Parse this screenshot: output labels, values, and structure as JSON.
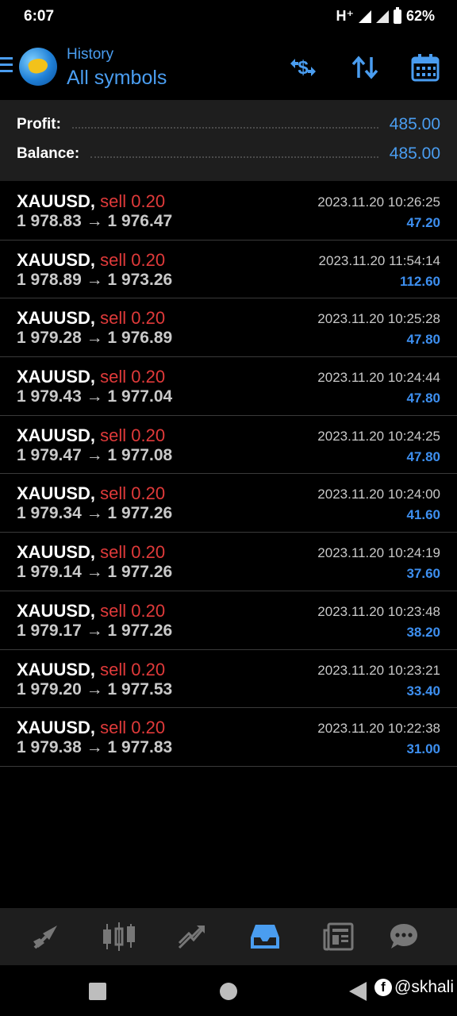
{
  "status_bar": {
    "time": "6:07",
    "network": "H⁺",
    "battery": "62%"
  },
  "header": {
    "subtitle": "History",
    "title": "All symbols",
    "icons": [
      "dollar-swap-icon",
      "sort-icon",
      "calendar-icon"
    ],
    "accent_color": "#4a9df0"
  },
  "summary": {
    "profit_label": "Profit:",
    "profit_value": "485.00",
    "balance_label": "Balance:",
    "balance_value": "485.00"
  },
  "deals": [
    {
      "symbol": "XAUUSD,",
      "side": "sell 0.20",
      "open": "1 978.83",
      "close": "1 976.47",
      "time": "2023.11.20 10:26:25",
      "profit": "47.20"
    },
    {
      "symbol": "XAUUSD,",
      "side": "sell 0.20",
      "open": "1 978.89",
      "close": "1 973.26",
      "time": "2023.11.20 11:54:14",
      "profit": "112.60"
    },
    {
      "symbol": "XAUUSD,",
      "side": "sell 0.20",
      "open": "1 979.28",
      "close": "1 976.89",
      "time": "2023.11.20 10:25:28",
      "profit": "47.80"
    },
    {
      "symbol": "XAUUSD,",
      "side": "sell 0.20",
      "open": "1 979.43",
      "close": "1 977.04",
      "time": "2023.11.20 10:24:44",
      "profit": "47.80"
    },
    {
      "symbol": "XAUUSD,",
      "side": "sell 0.20",
      "open": "1 979.47",
      "close": "1 977.08",
      "time": "2023.11.20 10:24:25",
      "profit": "47.80"
    },
    {
      "symbol": "XAUUSD,",
      "side": "sell 0.20",
      "open": "1 979.34",
      "close": "1 977.26",
      "time": "2023.11.20 10:24:00",
      "profit": "41.60"
    },
    {
      "symbol": "XAUUSD,",
      "side": "sell 0.20",
      "open": "1 979.14",
      "close": "1 977.26",
      "time": "2023.11.20 10:24:19",
      "profit": "37.60"
    },
    {
      "symbol": "XAUUSD,",
      "side": "sell 0.20",
      "open": "1 979.17",
      "close": "1 977.26",
      "time": "2023.11.20 10:23:48",
      "profit": "38.20"
    },
    {
      "symbol": "XAUUSD,",
      "side": "sell 0.20",
      "open": "1 979.20",
      "close": "1 977.53",
      "time": "2023.11.20 10:23:21",
      "profit": "33.40"
    },
    {
      "symbol": "XAUUSD,",
      "side": "sell 0.20",
      "open": "1 979.38",
      "close": "1 977.83",
      "time": "2023.11.20 10:22:38",
      "profit": "31.00"
    }
  ],
  "arrow": "→",
  "bottom_nav": {
    "items": [
      "quotes-icon",
      "chart-icon",
      "trade-icon",
      "history-icon",
      "news-icon",
      "chat-icon"
    ],
    "active": "history-icon"
  },
  "watermark": "@skhali",
  "colors": {
    "sell": "#e03a3a",
    "profit": "#3d8ff0",
    "background": "#000000",
    "panel": "#1e1e1e"
  }
}
